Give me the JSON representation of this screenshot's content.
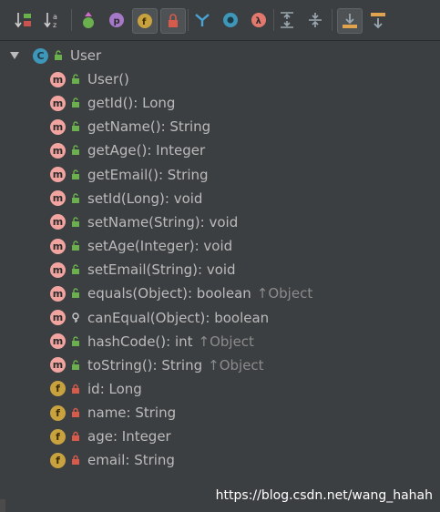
{
  "toolbar": {
    "buttons": [
      {
        "icon": "sort-by-visibility-icon"
      },
      {
        "icon": "sort-alphabetically-icon"
      },
      {
        "icon": "show-inherited-icon"
      },
      {
        "icon": "show-properties-icon"
      },
      {
        "icon": "show-fields-icon"
      },
      {
        "icon": "show-non-public-icon"
      },
      {
        "icon": "show-anonymous-icon"
      },
      {
        "icon": "show-lambdas-icon"
      },
      {
        "icon": "lambda-icon"
      },
      {
        "icon": "expand-all-icon"
      },
      {
        "icon": "collapse-all-icon"
      },
      {
        "icon": "autoscroll-to-source-icon"
      },
      {
        "icon": "autoscroll-from-source-icon"
      }
    ]
  },
  "root": {
    "label": "User",
    "badge": "C"
  },
  "members": [
    {
      "badge": "m",
      "vis": "public",
      "text": "User()",
      "inherit": ""
    },
    {
      "badge": "m",
      "vis": "public",
      "text": "getId(): Long",
      "inherit": ""
    },
    {
      "badge": "m",
      "vis": "public",
      "text": "getName(): String",
      "inherit": ""
    },
    {
      "badge": "m",
      "vis": "public",
      "text": "getAge(): Integer",
      "inherit": ""
    },
    {
      "badge": "m",
      "vis": "public",
      "text": "getEmail(): String",
      "inherit": ""
    },
    {
      "badge": "m",
      "vis": "public",
      "text": "setId(Long): void",
      "inherit": ""
    },
    {
      "badge": "m",
      "vis": "public",
      "text": "setName(String): void",
      "inherit": ""
    },
    {
      "badge": "m",
      "vis": "public",
      "text": "setAge(Integer): void",
      "inherit": ""
    },
    {
      "badge": "m",
      "vis": "public",
      "text": "setEmail(String): void",
      "inherit": ""
    },
    {
      "badge": "m",
      "vis": "public",
      "text": "equals(Object): boolean",
      "inherit": "↑Object"
    },
    {
      "badge": "m",
      "vis": "protected",
      "text": "canEqual(Object): boolean",
      "inherit": ""
    },
    {
      "badge": "m",
      "vis": "public",
      "text": "hashCode(): int",
      "inherit": "↑Object"
    },
    {
      "badge": "m",
      "vis": "public",
      "text": "toString(): String",
      "inherit": "↑Object"
    },
    {
      "badge": "f",
      "vis": "private",
      "text": "id: Long",
      "inherit": ""
    },
    {
      "badge": "f",
      "vis": "private",
      "text": "name: String",
      "inherit": ""
    },
    {
      "badge": "f",
      "vis": "private",
      "text": "age: Integer",
      "inherit": ""
    },
    {
      "badge": "f",
      "vis": "private",
      "text": "email: String",
      "inherit": ""
    }
  ],
  "watermark": "https://blog.csdn.net/wang_hahah"
}
